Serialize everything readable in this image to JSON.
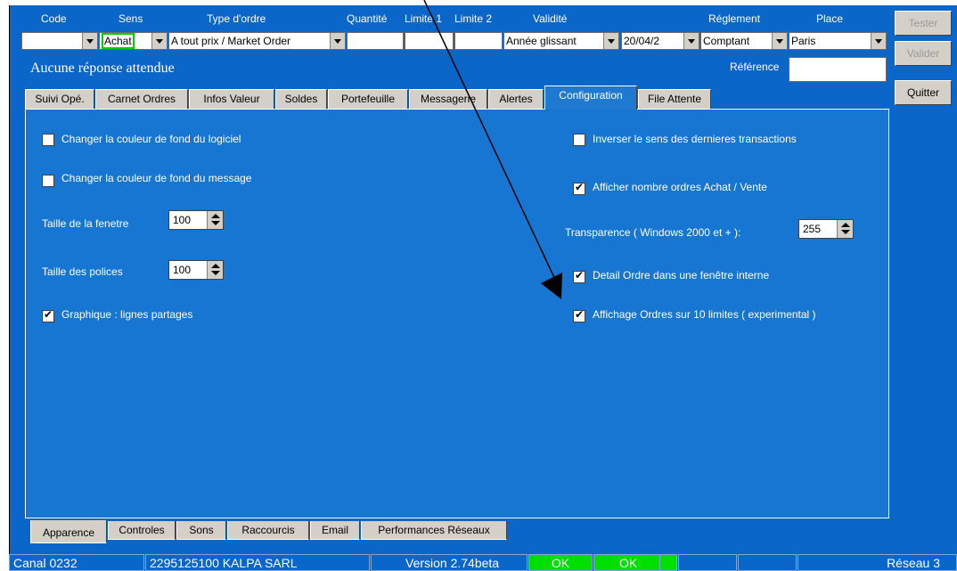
{
  "header_labels": {
    "code": "Code",
    "sens": "Sens",
    "type": "Type d'ordre",
    "quantite": "Quantité",
    "limite1": "Limite 1",
    "limite2": "Limite 2",
    "validite": "Validité",
    "reglement": "Réglement",
    "place": "Place"
  },
  "fields": {
    "code": "",
    "sens": "Achat",
    "type": "A tout prix / Market Order",
    "quantite": "",
    "limite1": "",
    "limite2": "",
    "validite": "Année glissant",
    "date": "20/04/2",
    "reglement": "Comptant",
    "place": "Paris"
  },
  "message": "Aucune réponse attendue",
  "reference_label": "Référence",
  "reference_value": "",
  "buttons": {
    "tester": "Tester",
    "valider": "Valider",
    "quitter": "Quitter"
  },
  "tabs": [
    "Suivi Opé.",
    "Carnet Ordres",
    "Infos Valeur",
    "Soldes",
    "Portefeuille",
    "Messagerie",
    "Alertes",
    "Configuration",
    "File Attente"
  ],
  "options": {
    "bg_software": "Changer la couleur de fond du logiciel",
    "bg_message": "Changer la couleur de fond du message",
    "window_size_label": "Taille de la fenetre",
    "window_size_value": "100",
    "font_size_label": "Taille des polices",
    "font_size_value": "100",
    "graph_lines": "Graphique : lignes partages",
    "invert": "Inverser le sens des dernieres transactions",
    "show_count": "Afficher nombre ordres Achat / Vente",
    "transparency_label": "Transparence ( Windows 2000 et + ):",
    "transparency_value": "255",
    "detail_order": "Detail Ordre dans une fenêtre interne",
    "ten_limits": "Affichage Ordres sur 10 limites ( experimental )"
  },
  "bottom_tabs": [
    "Apparence",
    "Controles",
    "Sons",
    "Raccourcis",
    "Email",
    "Performances Réseaux"
  ],
  "status": {
    "canal": "Canal 0232",
    "account": "2295125100  KALPA SARL",
    "version": "Version 2.74beta",
    "ok1": "OK",
    "ok2": "OK",
    "network": "Réseau 3"
  },
  "colors": {
    "background": "#0a66c8",
    "ok_green": "#00e000",
    "sens_highlight": "#00d000"
  }
}
